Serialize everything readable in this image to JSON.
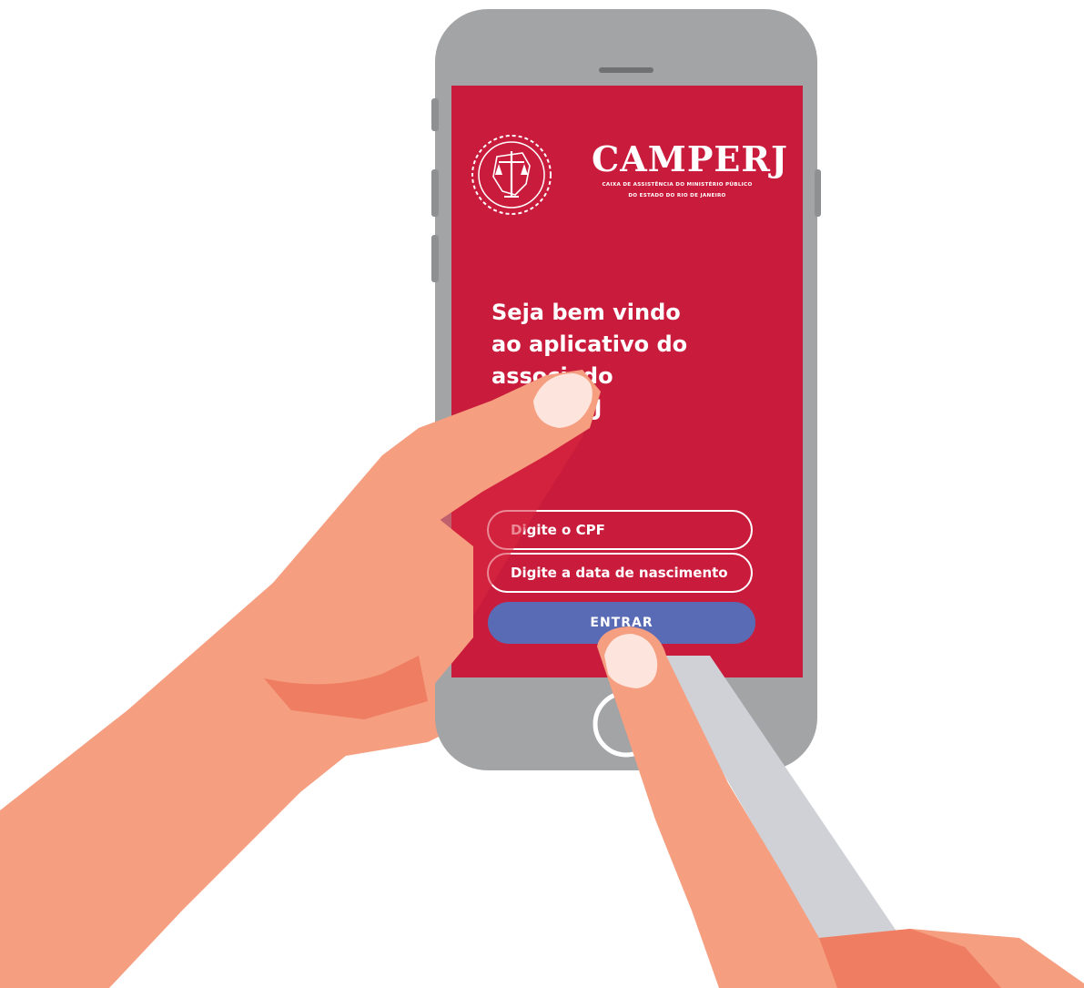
{
  "brand": {
    "name": "CAMPERJ",
    "subtitle_line1": "CAIXA DE ASSISTÊNCIA DO MINISTÉRIO PÚBLICO",
    "subtitle_line2": "DO ESTADO DO RIO DE JANEIRO",
    "logo_icon": "scales-of-justice-emblem-icon"
  },
  "welcome": {
    "line1": "Seja bem vindo",
    "line2": "ao aplicativo do",
    "line3": "associado",
    "line4": "CAMPERJ"
  },
  "form": {
    "cpf_placeholder": "Digite o CPF",
    "dob_placeholder": "Digite a data de nascimento",
    "submit_label": "ENTRAR"
  },
  "colors": {
    "screen_background": "#c91c3c",
    "button": "#5a6bb5",
    "phone_body": "#a2a4a6",
    "skin": "#f59e80"
  }
}
